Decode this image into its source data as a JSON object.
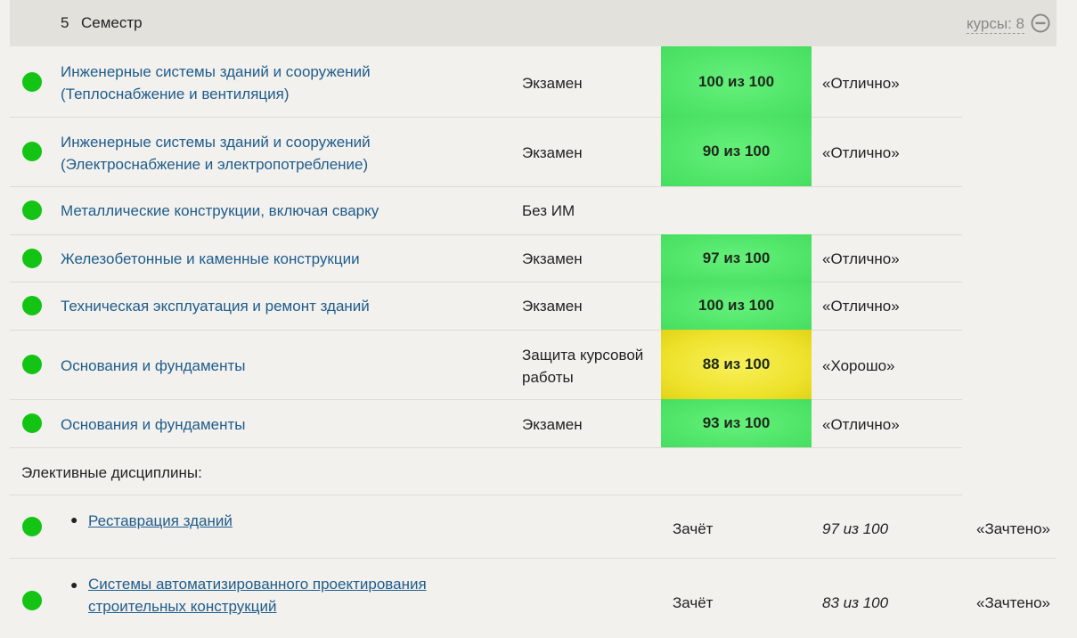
{
  "semester": {
    "number": "5",
    "title": "Семестр",
    "courses_label": "курсы: 8"
  },
  "courses": [
    {
      "name_line1": "Инженерные системы зданий и сооружений",
      "name_line2": "(Теплоснабжение и вентиляция)",
      "control_type": "Экзамен",
      "score": "100 из 100",
      "grade": "«Отлично»"
    },
    {
      "name_line1": "Инженерные системы зданий и сооружений",
      "name_line2": "(Электроснабжение и электропотребление)",
      "control_type": "Экзамен",
      "score": "90 из 100",
      "grade": "«Отлично»"
    },
    {
      "name_line1": "Металлические конструкции, включая сварку",
      "control_type": "Без ИМ"
    },
    {
      "name_line1": "Железобетонные и каменные конструкции",
      "control_type": "Экзамен",
      "score": "97 из 100",
      "grade": "«Отлично»"
    },
    {
      "name_line1": "Техническая эксплуатация и ремонт зданий",
      "control_type": "Экзамен",
      "score": "100 из 100",
      "grade": "«Отлично»"
    },
    {
      "name_line1": "Основания и фундаменты",
      "control_type_line1": "Защита курсовой",
      "control_type_line2": "работы",
      "score": "88 из 100",
      "grade": "«Хорошо»"
    },
    {
      "name_line1": "Основания и фундаменты",
      "control_type": "Экзамен",
      "score": "93 из 100",
      "grade": "«Отлично»"
    }
  ],
  "electives_label": "Элективные дисциплины:",
  "electives": [
    {
      "name_line1": "Реставрация зданий",
      "control_type": "Зачёт",
      "score": "97 из 100",
      "grade": "«Зачтено»"
    },
    {
      "name_line1": "Системы автоматизированного проектирования",
      "name_line2": "строительных конструкций",
      "control_type": "Зачёт",
      "score": "83 из 100",
      "grade": "«Зачтено»"
    }
  ],
  "colors": {
    "status_dot": "#14c414",
    "score_excellent": "#4ee468",
    "score_good": "#eee22c",
    "link": "#1f5c8c"
  },
  "icons": {
    "collapse": "minus-circle-icon",
    "status": "status-dot-icon"
  }
}
